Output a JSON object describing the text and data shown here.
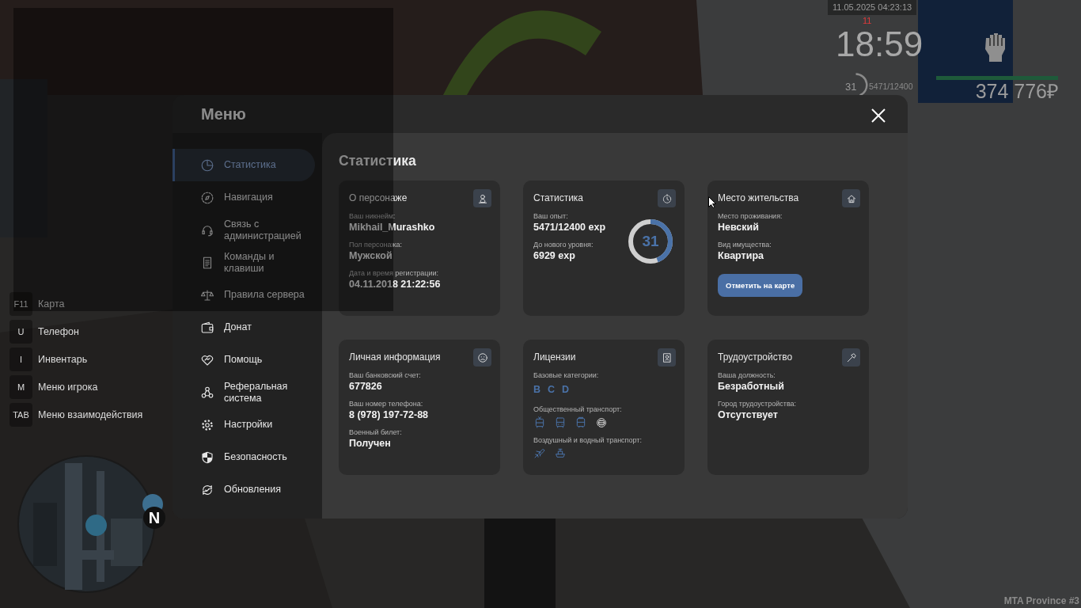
{
  "hud": {
    "datetime": "11.05.2025 04:23:13",
    "clock_badge": "11",
    "clock": "18:59",
    "player_level": "31",
    "experience": "5471/12400",
    "health": {
      "level": 1
    },
    "money": "374 776₽"
  },
  "hotkeys": [
    {
      "key": "F11",
      "label": "Карта"
    },
    {
      "key": "U",
      "label": "Телефон"
    },
    {
      "key": "I",
      "label": "Инвентарь"
    },
    {
      "key": "M",
      "label": "Меню игрока"
    },
    {
      "key": "TAB",
      "label": "Меню взаимодействия"
    }
  ],
  "minimap": {
    "compass": "N"
  },
  "menu": {
    "title": "Меню",
    "items": [
      {
        "label": "Статистика",
        "selected": true
      },
      {
        "label": "Навигация",
        "selected": false
      },
      {
        "label": "Связь с администрацией",
        "selected": false
      },
      {
        "label": "Команды и клавиши",
        "selected": false
      },
      {
        "label": "Правила сервера",
        "selected": false
      },
      {
        "label": "Донат",
        "selected": false
      },
      {
        "label": "Помощь",
        "selected": false
      },
      {
        "label": "Реферальная система",
        "selected": false
      },
      {
        "label": "Настройки",
        "selected": false
      },
      {
        "label": "Безопасность",
        "selected": false
      },
      {
        "label": "Обновления",
        "selected": false
      }
    ]
  },
  "page": {
    "title": "Статистика",
    "cards": [
      {
        "kind": "info",
        "title": "О персонаже",
        "fields": [
          {
            "label": "Ваш никнейм:",
            "value": "Mikhail_Murashko"
          },
          {
            "label": "Пол персонажа:",
            "value": "Мужской"
          },
          {
            "label": "Дата и время регистрации:",
            "value": "04.11.2018 21:22:56"
          }
        ]
      },
      {
        "kind": "info",
        "title": "Статистика",
        "fields": [
          {
            "label": "Ваш опыт:",
            "value": "5471/12400 exp"
          },
          {
            "label": "До нового уровня:",
            "value": "6929 exp"
          }
        ],
        "ring": {
          "value": "31",
          "level": 0.441
        }
      },
      {
        "kind": "info",
        "title": "Место жительства",
        "fields": [
          {
            "label": "Место проживания:",
            "value": "Невский"
          },
          {
            "label": "Вид имущества:",
            "value": "Квартира"
          }
        ],
        "button": "Отметить на карте"
      },
      {
        "kind": "info",
        "title": "Личная информация",
        "fields": [
          {
            "label": "Ваш банковский счет:",
            "value": "677826"
          },
          {
            "label": "Ваш номер телефона:",
            "value": "8 (978) 197-72-88"
          },
          {
            "label": "Военный билет:",
            "value": "Получен"
          }
        ]
      },
      {
        "kind": "licenses",
        "title": "Лицензии",
        "groups": [
          {
            "kind": "letters",
            "label": "Базовые категории:",
            "letters": [
              "B",
              "C",
              "D"
            ]
          },
          {
            "kind": "icons",
            "label": "Общественный транспорт:",
            "icons": [
              {
                "owned": true
              },
              {
                "owned": true
              },
              {
                "owned": true
              },
              {
                "owned": false
              }
            ]
          },
          {
            "kind": "icons",
            "label": "Воздушный и водный транспорт:",
            "icons": [
              {
                "owned": true
              },
              {
                "owned": true
              }
            ]
          }
        ]
      },
      {
        "kind": "info",
        "title": "Трудоустройство",
        "fields": [
          {
            "label": "Ваша должность:",
            "value": "Безработный"
          },
          {
            "label": "Город трудоустройства:",
            "value": "Отсутствует"
          }
        ]
      }
    ]
  },
  "footer": "MTA Province #3"
}
